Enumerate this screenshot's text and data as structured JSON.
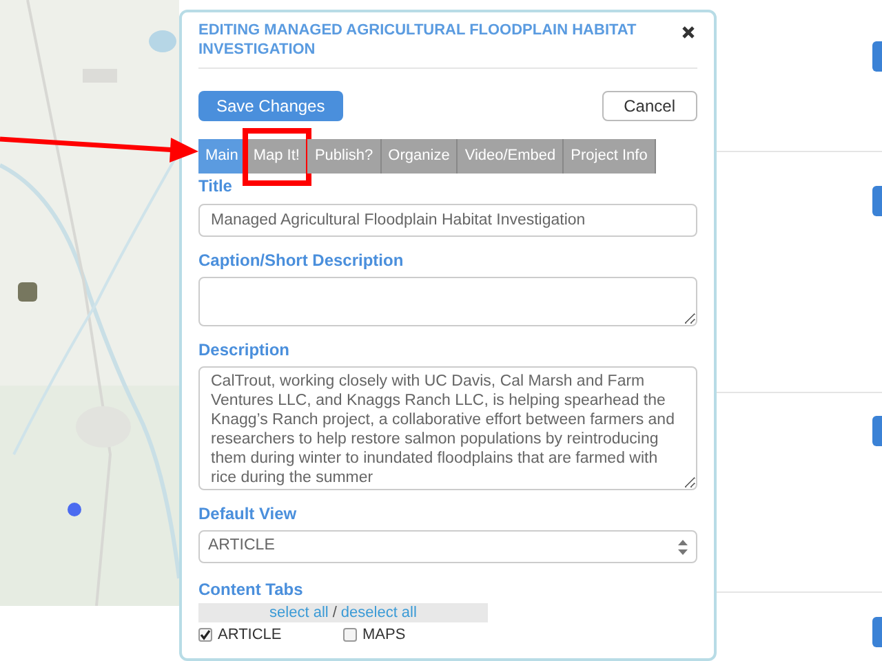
{
  "dialog": {
    "title": "EDITING MANAGED AGRICULTURAL FLOODPLAIN HABITAT INVESTIGATION",
    "buttons": [
      {
        "label": "Save Changes",
        "kind": "primary"
      },
      {
        "label": "Cancel",
        "kind": "secondary"
      }
    ],
    "tabs": [
      {
        "label": "Main",
        "selected": true,
        "highlighted": false
      },
      {
        "label": "Map It!",
        "selected": false,
        "highlighted": true
      },
      {
        "label": "Publish?",
        "selected": false,
        "highlighted": false
      },
      {
        "label": "Organize",
        "selected": false,
        "highlighted": false
      },
      {
        "label": "Video/Embed",
        "selected": false,
        "highlighted": false
      },
      {
        "label": "Project Info",
        "selected": false,
        "highlighted": false
      }
    ],
    "fields": [
      {
        "label": "Title",
        "kind": "input",
        "value": "Managed Agricultural Floodplain Habitat Investigation"
      },
      {
        "label": "Caption/Short Description",
        "kind": "textarea"
      },
      {
        "label": "Description",
        "kind": "textarea",
        "value": "CalTrout, working closely with UC Davis, Cal Marsh and Farm Ventures LLC, and Knaggs Ranch LLC, is helping spearhead the Knagg’s Ranch project, a collaborative effort between farmers and researchers to help restore salmon populations by reintroducing them during winter to inundated floodplains that are farmed with rice during the summer"
      },
      {
        "label": "Default View",
        "kind": "select",
        "value": "ARTICLE"
      }
    ],
    "content_tabs": {
      "label": "Content Tabs",
      "select_all": "select all",
      "separator": "/",
      "deselect_all": "deselect all",
      "options": [
        {
          "label": "ARTICLE",
          "checked": true
        },
        {
          "label": "MAPS",
          "checked": false
        }
      ]
    }
  }
}
